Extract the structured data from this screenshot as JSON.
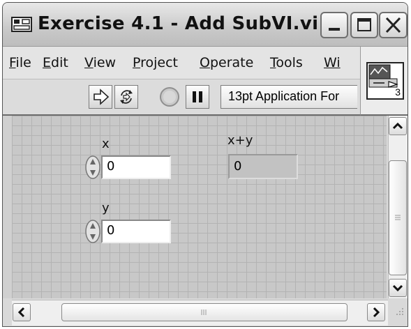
{
  "window": {
    "title": "Exercise 4.1 - Add SubVI.vi ...",
    "app_icon": "labview-vi-icon",
    "controls": [
      "minimize-icon",
      "maximize-icon",
      "close-icon"
    ]
  },
  "menubar": {
    "items": [
      {
        "underline": "F",
        "rest": "ile"
      },
      {
        "underline": "E",
        "rest": "dit"
      },
      {
        "underline": "V",
        "rest": "iew"
      },
      {
        "underline": "P",
        "rest": "roject"
      },
      {
        "underline": "O",
        "rest": "perate"
      },
      {
        "underline": "T",
        "rest": "ools"
      },
      {
        "underline": "Wi",
        "rest": ""
      }
    ]
  },
  "toolbar": {
    "buttons": [
      "run-arrow-icon",
      "run-continuously-icon",
      "abort-execution-icon",
      "pause-icon"
    ],
    "font_selector": "13pt Application For"
  },
  "connector_pane": {
    "terminal_count": "3"
  },
  "front_panel": {
    "controls": [
      {
        "label": "x",
        "value": "0",
        "kind": "numeric-control"
      },
      {
        "label": "y",
        "value": "0",
        "kind": "numeric-control"
      }
    ],
    "indicators": [
      {
        "label": "x+y",
        "value": "0",
        "kind": "numeric-indicator"
      }
    ]
  },
  "scrollbars": {
    "vertical": {
      "up": "chevron-up-icon",
      "down": "chevron-down-icon",
      "grip": "|||"
    },
    "horizontal": {
      "left": "chevron-left-icon",
      "right": "chevron-right-icon",
      "grip": "|||"
    }
  }
}
